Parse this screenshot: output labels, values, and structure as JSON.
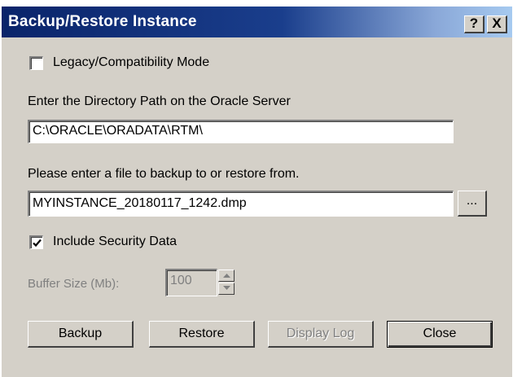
{
  "window": {
    "title": "Backup/Restore Instance",
    "help_label": "?",
    "close_label": "X"
  },
  "legacy_mode": {
    "label": "Legacy/Compatibility Mode",
    "checked": false
  },
  "directory": {
    "label": "Enter the Directory Path on the Oracle Server",
    "value": "C:\\ORACLE\\ORADATA\\RTM\\"
  },
  "file": {
    "label": "Please enter a file to backup to or restore from.",
    "value": "MYINSTANCE_20180117_1242.dmp",
    "browse_label": "..."
  },
  "security": {
    "label": "Include Security Data",
    "checked": true
  },
  "buffer": {
    "label": "Buffer Size (Mb):",
    "value": "100"
  },
  "buttons": {
    "backup": "Backup",
    "restore": "Restore",
    "display_log": "Display Log",
    "close": "Close"
  },
  "colors": {
    "title_bar": "#0a246a",
    "face": "#d4d0c8",
    "disabled_text": "#808080"
  }
}
